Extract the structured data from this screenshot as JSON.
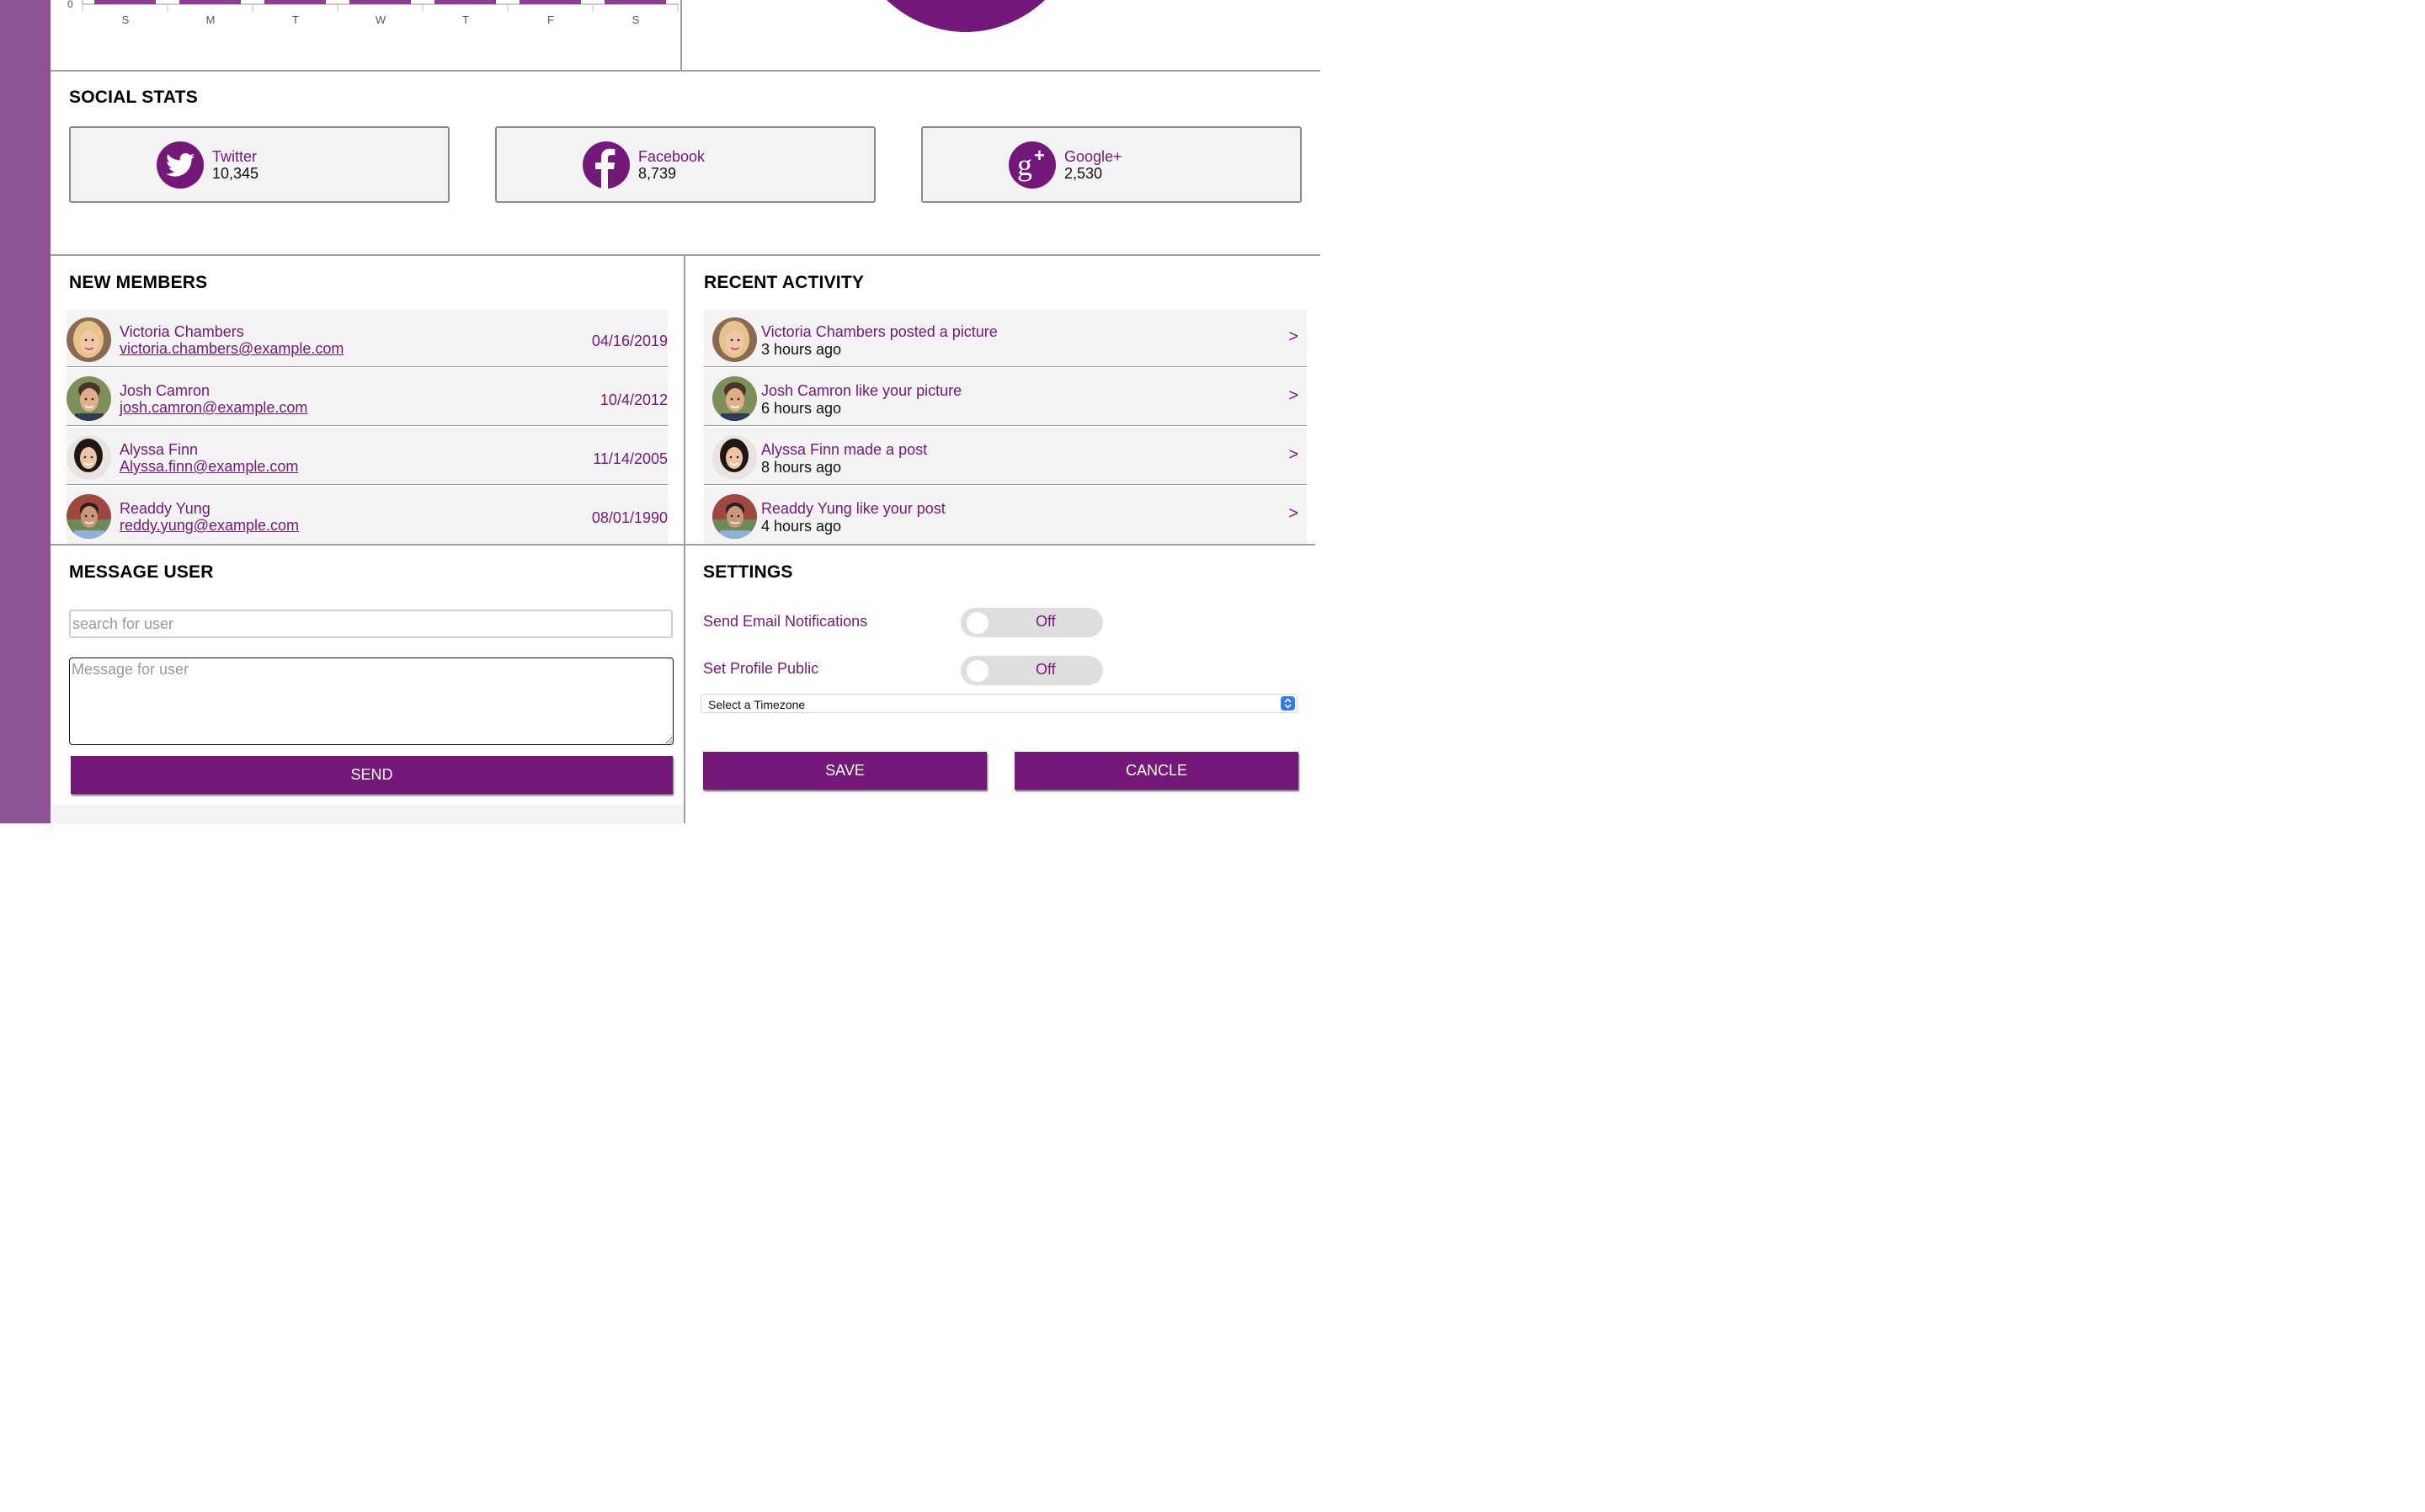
{
  "chart": {
    "zero_tick": "0",
    "days": [
      "S",
      "M",
      "T",
      "W",
      "T",
      "F",
      "S"
    ]
  },
  "social": {
    "title": "SOCIAL STATS",
    "cards": [
      {
        "name": "Twitter",
        "count": "10,345",
        "icon": "twitter-icon"
      },
      {
        "name": "Facebook",
        "count": "8,739",
        "icon": "facebook-icon"
      },
      {
        "name": "Google+",
        "count": "2,530",
        "icon": "google-plus-icon"
      }
    ]
  },
  "members": {
    "title": "NEW MEMBERS",
    "items": [
      {
        "name": "Victoria Chambers",
        "email": "victoria.chambers@example.com",
        "date": "04/16/2019"
      },
      {
        "name": "Josh Camron",
        "email": "josh.camron@example.com",
        "date": "10/4/2012"
      },
      {
        "name": "Alyssa Finn",
        "email": "Alyssa.finn@example.com",
        "date": "11/14/2005"
      },
      {
        "name": "Readdy Yung",
        "email": "reddy.yung@example.com",
        "date": "08/01/1990"
      }
    ]
  },
  "activity": {
    "title": "RECENT ACTIVITY",
    "arrow": ">",
    "items": [
      {
        "text": "Victoria Chambers posted a picture",
        "time": "3 hours ago"
      },
      {
        "text": "Josh Camron like your picture",
        "time": "6 hours ago"
      },
      {
        "text": "Alyssa Finn made a post",
        "time": "8 hours ago"
      },
      {
        "text": "Readdy Yung like your post",
        "time": "4 hours ago"
      }
    ]
  },
  "message": {
    "title": "MESSAGE USER",
    "search_placeholder": "search for user",
    "message_placeholder": "Message for user",
    "send_label": "SEND"
  },
  "settings": {
    "title": "SETTINGS",
    "email_label": "Send Email Notifications",
    "email_state": "Off",
    "public_label": "Set Profile Public",
    "public_state": "Off",
    "timezone_value": "Select a Timezone",
    "save_label": "SAVE",
    "cancel_label": "CANCLE"
  },
  "colors": {
    "accent": "#74197a",
    "sidebar": "#8d5394"
  }
}
